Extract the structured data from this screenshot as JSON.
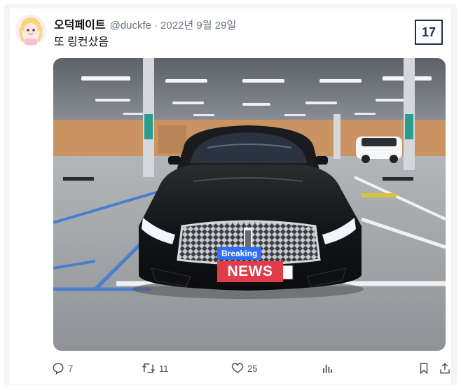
{
  "tweet": {
    "display_name": "오덕페이트",
    "handle": "@duckfe",
    "separator": "·",
    "date": "2022년 9월 29일",
    "text": "또 링컨샀음"
  },
  "badge": {
    "number": "17"
  },
  "media": {
    "caption_top": "Breaking",
    "caption_main": "NEWS"
  },
  "actions": {
    "replies": "7",
    "retweets": "11",
    "likes": "25",
    "views": "",
    "bookmark_icon": "bookmark-icon",
    "share_icon": "share-icon"
  },
  "colors": {
    "badge_border": "#1f2d5c",
    "breaking_bg": "#2f6ff2",
    "news_bg": "#e23b4a",
    "icon_gray": "#4b5563"
  }
}
